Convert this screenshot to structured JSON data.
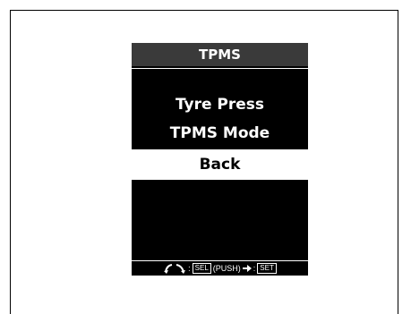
{
  "screen": {
    "title": "TPMS",
    "menu": [
      {
        "label": "Tyre Press",
        "selected": false
      },
      {
        "label": "TPMS Mode",
        "selected": false
      },
      {
        "label": "Back",
        "selected": true
      }
    ],
    "hint": {
      "rotate_icon": "rotate-arrows-icon",
      "colon": ":",
      "sel": "SEL",
      "push": "(PUSH)",
      "arrow_icon": "push-arrow-icon",
      "set_colon": ":",
      "set": "SET"
    }
  }
}
